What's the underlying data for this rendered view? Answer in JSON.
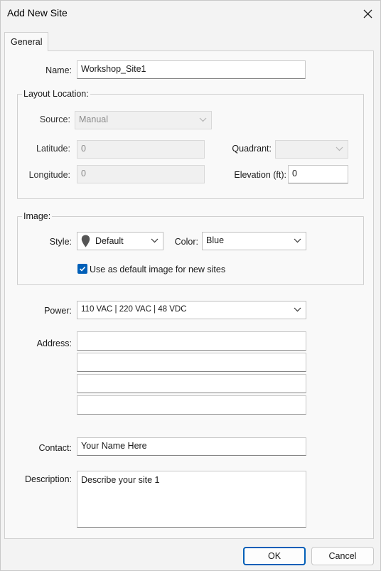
{
  "window": {
    "title": "Add New Site"
  },
  "tabs": {
    "general": "General"
  },
  "name": {
    "label": "Name:",
    "value": "Workshop_Site1"
  },
  "layout_location": {
    "title": "Layout Location:",
    "source_label": "Source:",
    "source_value": "Manual",
    "latitude_label": "Latitude:",
    "latitude_value": "0",
    "longitude_label": "Longitude:",
    "longitude_value": "0",
    "quadrant_label": "Quadrant:",
    "quadrant_value": "",
    "elevation_label": "Elevation (ft):",
    "elevation_value": "0"
  },
  "image": {
    "title": "Image:",
    "style_label": "Style:",
    "style_value": "Default",
    "style_icon": "map-pin-icon",
    "color_label": "Color:",
    "color_value": "Blue",
    "default_checkbox_label": "Use as default image for new sites",
    "default_checked": true
  },
  "power": {
    "label": "Power:",
    "value": "110 VAC | 220 VAC | 48 VDC"
  },
  "address": {
    "label": "Address:",
    "lines": [
      "",
      "",
      "",
      ""
    ]
  },
  "contact": {
    "label": "Contact:",
    "value": "Your Name Here"
  },
  "description": {
    "label": "Description:",
    "value": "Describe your site 1"
  },
  "buttons": {
    "ok": "OK",
    "cancel": "Cancel"
  },
  "colors": {
    "accent": "#005fb8",
    "background": "#f3f3f3",
    "panel": "#f9f9f9"
  }
}
